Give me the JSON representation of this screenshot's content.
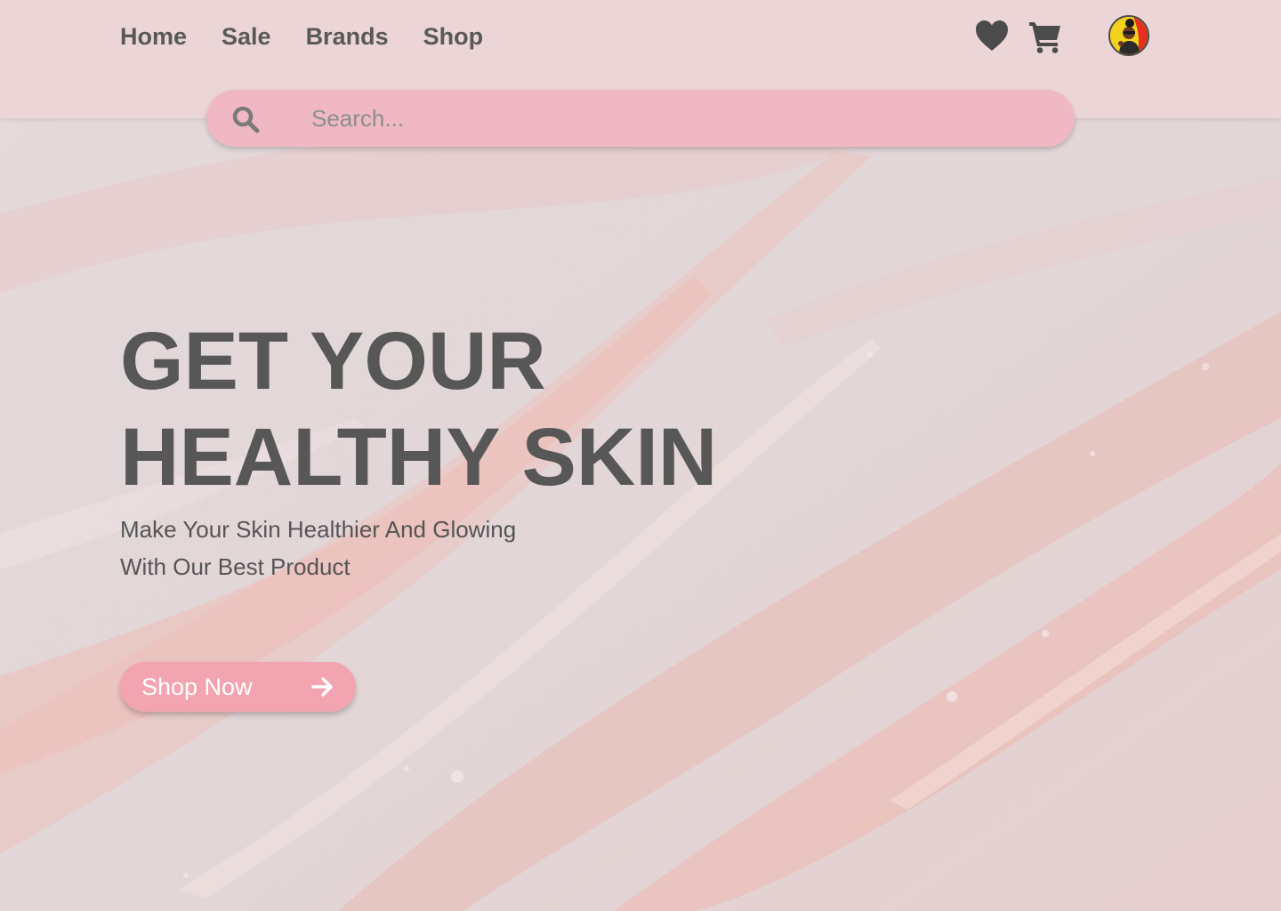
{
  "nav": {
    "items": [
      {
        "label": "Home"
      },
      {
        "label": "Sale"
      },
      {
        "label": "Brands"
      },
      {
        "label": "Shop"
      }
    ]
  },
  "header": {
    "icons": [
      "heart-icon",
      "cart-icon",
      "avatar"
    ]
  },
  "search": {
    "placeholder": "Search..."
  },
  "hero": {
    "title_line1": "GET YOUR",
    "title_line2": "HEALTHY SKIN",
    "subtitle_line1": "Make Your Skin Healthier And Glowing",
    "subtitle_line2": "With Our Best Product",
    "cta_label": "Shop Now"
  },
  "colors": {
    "header_bg": "#ecd5d7",
    "search_bg": "#efb8c3",
    "button_bg": "#f2a5b0",
    "text_dark": "#575757",
    "icon_color": "#4b4b4b"
  }
}
